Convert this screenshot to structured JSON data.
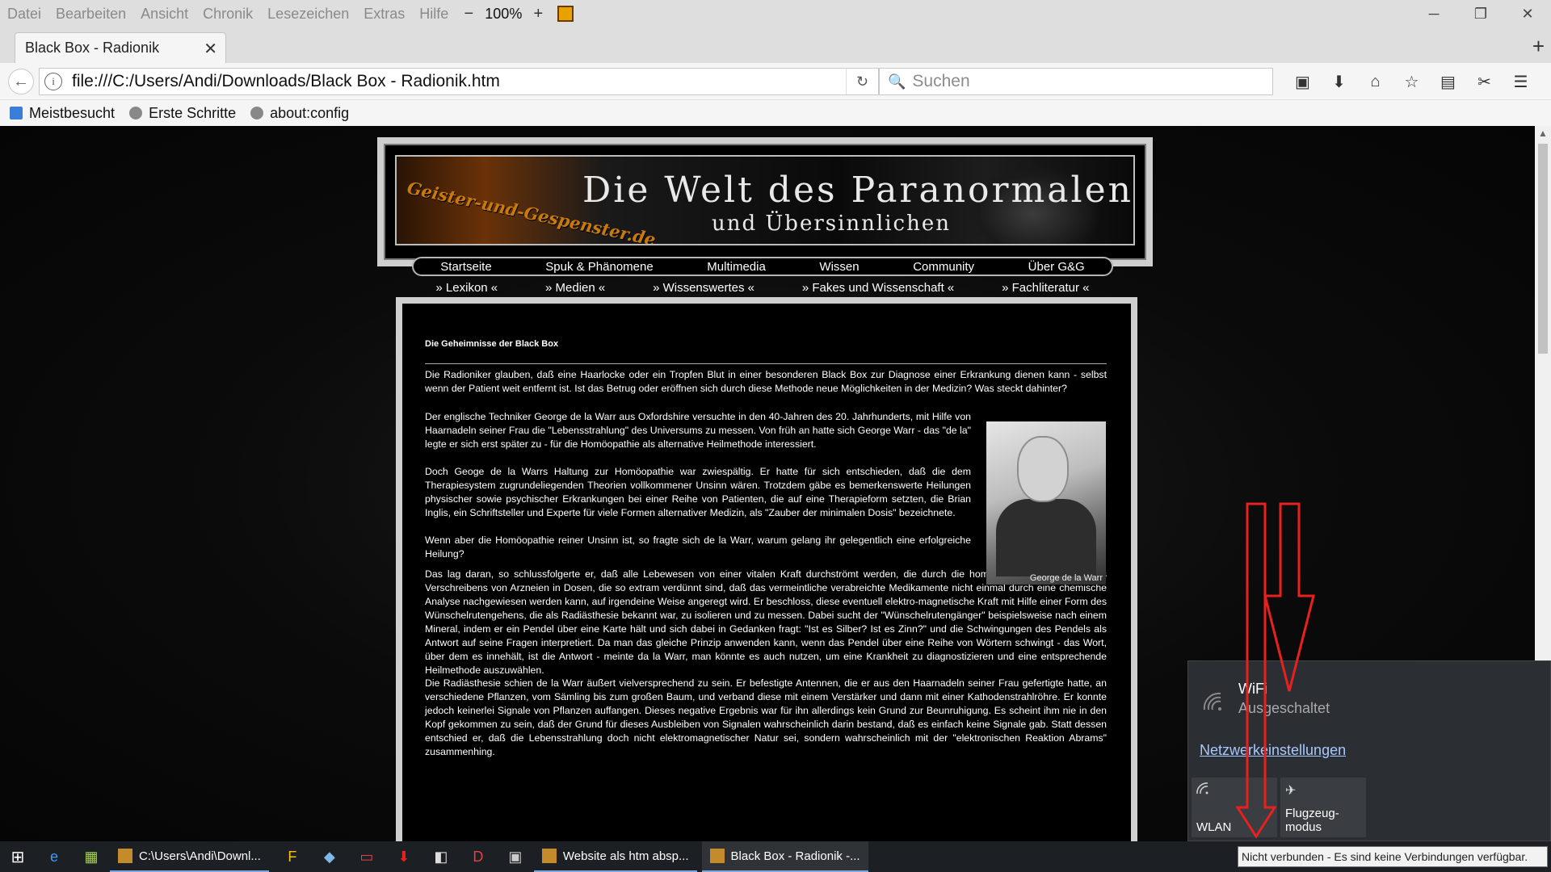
{
  "menubar": {
    "items": [
      "Datei",
      "Bearbeiten",
      "Ansicht",
      "Chronik",
      "Lesezeichen",
      "Extras",
      "Hilfe"
    ],
    "zoom_out": "−",
    "zoom": "100%",
    "zoom_in": "+"
  },
  "window_controls": {
    "minimize": "─",
    "restore": "❐",
    "close": "✕"
  },
  "tab": {
    "title": "Black Box - Radionik",
    "close": "✕",
    "new": "+"
  },
  "nav": {
    "back": "←",
    "info": "i",
    "url": "file:///C:/Users/Andi/Downloads/Black Box - Radionik.htm",
    "reload": "↻",
    "search_icon": "🔍",
    "search_placeholder": "Suchen",
    "icons": [
      "▣",
      "⬇",
      "⌂",
      "☆",
      "▤",
      "✂",
      "☰"
    ]
  },
  "bookmarks": [
    "Meistbesucht",
    "Erste Schritte",
    "about:config"
  ],
  "page": {
    "header_logo": "Geister-und-Gespenster.de",
    "header_title": "Die Welt des Paranormalen",
    "header_subtitle": "und Übersinnlichen",
    "mainnav": [
      "Startseite",
      "Spuk & Phänomene",
      "Multimedia",
      "Wissen",
      "Community",
      "Über G&G"
    ],
    "subnav": [
      "» Lexikon «",
      "» Medien «",
      "» Wissenswertes «",
      "» Fakes und Wissenschaft «",
      "» Fachliteratur «"
    ],
    "article_title": "Die Geheimnisse der Black Box",
    "paragraphs": [
      "Die Radioniker glauben, daß eine Haarlocke oder ein Tropfen Blut in einer besonderen Black Box zur Diagnose einer Erkrankung dienen kann - selbst wenn der Patient weit entfernt ist. Ist das Betrug oder eröffnen sich durch diese Methode neue Möglichkeiten in der Medizin? Was steckt dahinter?",
      "Der englische Techniker George de la Warr aus Oxfordshire versuchte in den 40-Jahren des 20. Jahrhunderts, mit Hilfe von Haarnadeln seiner Frau die \"Lebensstrahlung\" des Universums zu messen. Von früh an hatte sich George Warr - das \"de la\" legte er sich erst später zu - für die Homöopathie als alternative Heilmethode interessiert.",
      "Doch Geoge de la Warrs Haltung zur Homöopathie war zwiespältig. Er hatte für sich entschieden, daß die dem Therapiesystem zugrundeliegenden Theorien vollkommener Unsinn wären. Trotzdem gäbe es bemerkenswerte Heilungen physischer sowie psychischer Erkrankungen bei einer Reihe von Patienten, die auf eine Therapieform setzten, die Brian Inglis, ein Schriftsteller und Experte für viele Formen alternativer Medizin, als \"Zauber der minimalen Dosis\" bezeichnete.",
      "Wenn aber die Homöopathie reiner Unsinn ist, so fragte sich de la Warr, warum gelang ihr gelegentlich eine erfolgreiche Heilung?",
      "Das lag daran, so schlussfolgerte er, daß alle Lebewesen von einer vitalen Kraft durchströmt werden, die durch die homöopathische Methode des Verschreibens von Arzneien in Dosen, die so extram verdünnt sind, daß das vermeintliche verabreichte Medikamente nicht einmal durch eine chemische Analyse nachgewiesen werden kann, auf irgendeine Weise angeregt wird. Er beschloss, diese eventuell elektro-magnetische Kraft mit Hilfe einer Form des Wünschelrutengehens, die als Radiästhesie bekannt war, zu isolieren und zu messen. Dabei sucht der \"Wünschelrutengänger\" beispielsweise nach einem Mineral, indem er ein Pendel über eine Karte hält und sich dabei in Gedanken fragt: \"Ist es Silber? Ist es Zinn?\" und die Schwingungen des Pendels als Antwort auf seine Fragen interpretiert. Da man das gleiche Prinzip anwenden kann, wenn das Pendel über eine Reihe von Wörtern schwingt - das Wort, über dem es innehält, ist die Antwort - meinte da la Warr, man könnte es auch nutzen, um eine Krankheit zu diagnostizieren und eine entsprechende Heilmethode auszuwählen.",
      "Die Radiästhesie schien de la Warr äußert vielversprechend zu sein. Er befestigte Antennen, die er aus den Haarnadeln seiner Frau gefertigte hatte, an verschiedene Pflanzen, vom Sämling bis zum großen Baum, und verband diese mit einem Verstärker und dann mit einer Kathodenstrahlröhre. Er konnte jedoch keinerlei Signale von Pflanzen auffangen. Dieses negative Ergebnis war für ihn allerdings kein Grund zur Beunruhigung. Es scheint ihm nie in den Kopf gekommen zu sein, daß der Grund für dieses Ausbleiben von Signalen wahrscheinlich darin bestand, daß es einfach keine Signale gab. Statt dessen entschied er, daß die Lebensstrahlung doch nicht elektromagnetischer Natur sei, sondern wahrscheinlich mit der \"elektronischen Reaktion Abrams\" zusammenhing."
    ],
    "photo_caption": "George de la Warr"
  },
  "taskbar": {
    "start": "⊞",
    "icons": [
      "e",
      "▦",
      "F",
      "◆",
      "▭",
      "⬇",
      "◧",
      "D",
      "▣"
    ],
    "buttons": [
      "C:\\Users\\Andi\\Downl...",
      "Website als htm absp...",
      "Black Box - Radionik -..."
    ]
  },
  "network": {
    "wifi_name": "WiFi",
    "wifi_state": "Ausgeschaltet",
    "settings_link": "Netzwerkeinstellungen",
    "tile_wlan": "WLAN",
    "tile_flight": "Flugzeug-\nmodus",
    "tooltip": "Nicht verbunden - Es sind keine Verbindungen verfügbar."
  },
  "colors": {
    "annotation_arrow": "#e8201e",
    "link": "#a8c8ff"
  }
}
